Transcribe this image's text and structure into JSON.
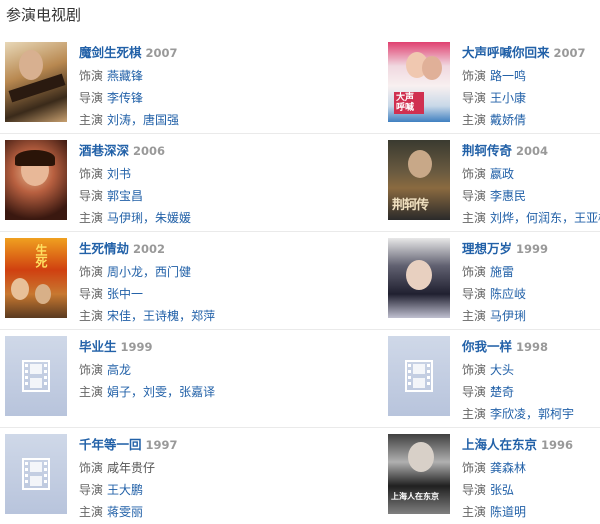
{
  "section_title": "参演电视剧",
  "labels": {
    "role": "饰演",
    "director": "导演",
    "starring": "主演"
  },
  "items": [
    {
      "title": "魔剑生死棋",
      "year": "2007",
      "role": [
        "燕藏锋"
      ],
      "director": [
        "李传锋"
      ],
      "starring": [
        "刘涛",
        "唐国强"
      ]
    },
    {
      "title": "大声呼喊你回来",
      "year": "2007",
      "role": [
        "路一鸣"
      ],
      "director": [
        "王小康"
      ],
      "starring": [
        "戴娇倩"
      ]
    },
    {
      "title": "酒巷深深",
      "year": "2006",
      "role": [
        "刘书"
      ],
      "director": [
        "郭宝昌"
      ],
      "starring": [
        "马伊琍",
        "朱媛媛"
      ]
    },
    {
      "title": "荆轲传奇",
      "year": "2004",
      "role": [
        "嬴政"
      ],
      "director": [
        "李惠民"
      ],
      "starring": [
        "刘烨",
        "何润东",
        "王亚楠"
      ]
    },
    {
      "title": "生死情劫",
      "year": "2002",
      "role": [
        "周小龙",
        "西门健"
      ],
      "director": [
        "张中一"
      ],
      "starring": [
        "宋佳",
        "王诗槐",
        "郑萍"
      ]
    },
    {
      "title": "理想万岁",
      "year": "1999",
      "role": [
        "施雷"
      ],
      "director": [
        "陈应岐"
      ],
      "starring": [
        "马伊琍"
      ]
    },
    {
      "title": "毕业生",
      "year": "1999",
      "role": [
        "高龙"
      ],
      "starring": [
        "娟子",
        "刘雯",
        "张嘉译"
      ]
    },
    {
      "title": "你我一样",
      "year": "1998",
      "role": [
        "大头"
      ],
      "director": [
        "楚奇"
      ],
      "starring": [
        "李欣凌",
        "郭柯宇"
      ]
    },
    {
      "title": "千年等一回",
      "year": "1997",
      "role_plain": "咸年贵仔",
      "director": [
        "王大鹏"
      ],
      "starring": [
        "蒋雯丽"
      ]
    },
    {
      "title": "上海人在东京",
      "year": "1996",
      "role": [
        "龚森林"
      ],
      "director": [
        "张弘"
      ],
      "starring": [
        "陈道明"
      ]
    }
  ],
  "poster_texts": {
    "p2": "大声呼喊",
    "p4": "荆轲传",
    "p5": "生死",
    "p7": "上海人在东京"
  }
}
